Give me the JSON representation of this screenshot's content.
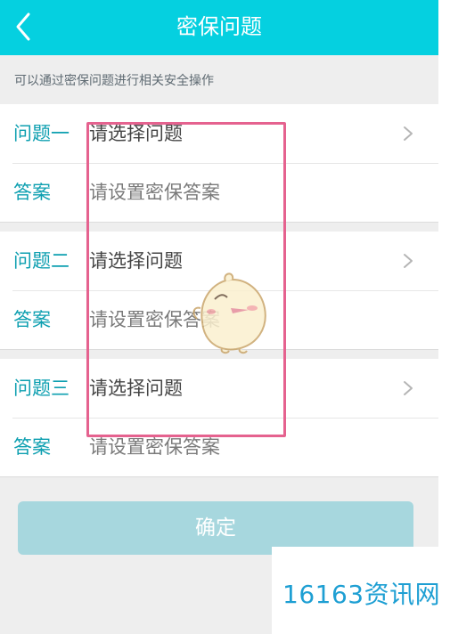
{
  "header": {
    "title": "密保问题"
  },
  "hint": "可以通过密保问题进行相关安全操作",
  "groups": [
    {
      "question_label": "问题一",
      "question_value": "请选择问题",
      "answer_label": "答案",
      "answer_placeholder": "请设置密保答案"
    },
    {
      "question_label": "问题二",
      "question_value": "请选择问题",
      "answer_label": "答案",
      "answer_placeholder": "请设置密保答案"
    },
    {
      "question_label": "问题三",
      "question_value": "请选择问题",
      "answer_label": "答案",
      "answer_placeholder": "请设置密保答案"
    }
  ],
  "confirm_button": {
    "label": "确定"
  },
  "watermark": {
    "text": "16163资讯网"
  },
  "icons": {
    "back": "back-arrow-icon",
    "chevron": "chevron-right-icon",
    "mascot": "chick-mascot-icon"
  },
  "colors": {
    "header_bg": "#05d0e0",
    "label": "#0d9fb0",
    "button_bg": "#a7d7de",
    "highlight": "#e5628f",
    "watermark": "#1e9fd3",
    "page_bg": "#eeeeee"
  }
}
